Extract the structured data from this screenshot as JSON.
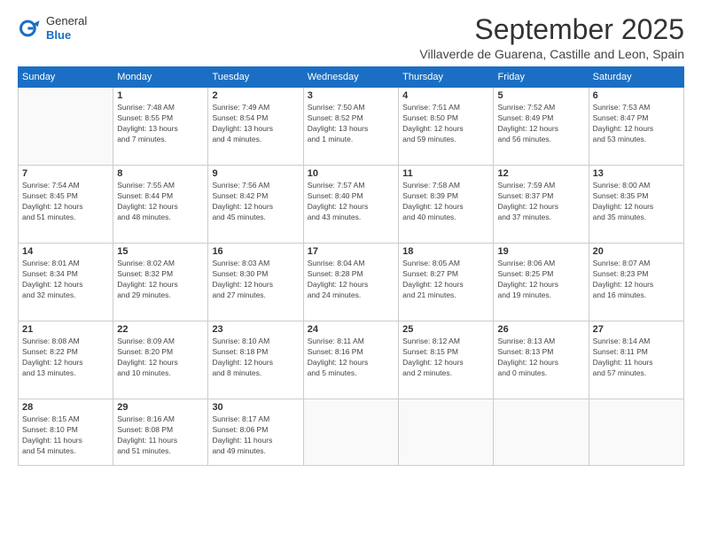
{
  "header": {
    "logo": {
      "line1": "General",
      "line2": "Blue"
    },
    "title": "September 2025",
    "location": "Villaverde de Guarena, Castille and Leon, Spain"
  },
  "weekdays": [
    "Sunday",
    "Monday",
    "Tuesday",
    "Wednesday",
    "Thursday",
    "Friday",
    "Saturday"
  ],
  "weeks": [
    [
      {
        "day": "",
        "info": ""
      },
      {
        "day": "1",
        "info": "Sunrise: 7:48 AM\nSunset: 8:55 PM\nDaylight: 13 hours\nand 7 minutes."
      },
      {
        "day": "2",
        "info": "Sunrise: 7:49 AM\nSunset: 8:54 PM\nDaylight: 13 hours\nand 4 minutes."
      },
      {
        "day": "3",
        "info": "Sunrise: 7:50 AM\nSunset: 8:52 PM\nDaylight: 13 hours\nand 1 minute."
      },
      {
        "day": "4",
        "info": "Sunrise: 7:51 AM\nSunset: 8:50 PM\nDaylight: 12 hours\nand 59 minutes."
      },
      {
        "day": "5",
        "info": "Sunrise: 7:52 AM\nSunset: 8:49 PM\nDaylight: 12 hours\nand 56 minutes."
      },
      {
        "day": "6",
        "info": "Sunrise: 7:53 AM\nSunset: 8:47 PM\nDaylight: 12 hours\nand 53 minutes."
      }
    ],
    [
      {
        "day": "7",
        "info": "Sunrise: 7:54 AM\nSunset: 8:45 PM\nDaylight: 12 hours\nand 51 minutes."
      },
      {
        "day": "8",
        "info": "Sunrise: 7:55 AM\nSunset: 8:44 PM\nDaylight: 12 hours\nand 48 minutes."
      },
      {
        "day": "9",
        "info": "Sunrise: 7:56 AM\nSunset: 8:42 PM\nDaylight: 12 hours\nand 45 minutes."
      },
      {
        "day": "10",
        "info": "Sunrise: 7:57 AM\nSunset: 8:40 PM\nDaylight: 12 hours\nand 43 minutes."
      },
      {
        "day": "11",
        "info": "Sunrise: 7:58 AM\nSunset: 8:39 PM\nDaylight: 12 hours\nand 40 minutes."
      },
      {
        "day": "12",
        "info": "Sunrise: 7:59 AM\nSunset: 8:37 PM\nDaylight: 12 hours\nand 37 minutes."
      },
      {
        "day": "13",
        "info": "Sunrise: 8:00 AM\nSunset: 8:35 PM\nDaylight: 12 hours\nand 35 minutes."
      }
    ],
    [
      {
        "day": "14",
        "info": "Sunrise: 8:01 AM\nSunset: 8:34 PM\nDaylight: 12 hours\nand 32 minutes."
      },
      {
        "day": "15",
        "info": "Sunrise: 8:02 AM\nSunset: 8:32 PM\nDaylight: 12 hours\nand 29 minutes."
      },
      {
        "day": "16",
        "info": "Sunrise: 8:03 AM\nSunset: 8:30 PM\nDaylight: 12 hours\nand 27 minutes."
      },
      {
        "day": "17",
        "info": "Sunrise: 8:04 AM\nSunset: 8:28 PM\nDaylight: 12 hours\nand 24 minutes."
      },
      {
        "day": "18",
        "info": "Sunrise: 8:05 AM\nSunset: 8:27 PM\nDaylight: 12 hours\nand 21 minutes."
      },
      {
        "day": "19",
        "info": "Sunrise: 8:06 AM\nSunset: 8:25 PM\nDaylight: 12 hours\nand 19 minutes."
      },
      {
        "day": "20",
        "info": "Sunrise: 8:07 AM\nSunset: 8:23 PM\nDaylight: 12 hours\nand 16 minutes."
      }
    ],
    [
      {
        "day": "21",
        "info": "Sunrise: 8:08 AM\nSunset: 8:22 PM\nDaylight: 12 hours\nand 13 minutes."
      },
      {
        "day": "22",
        "info": "Sunrise: 8:09 AM\nSunset: 8:20 PM\nDaylight: 12 hours\nand 10 minutes."
      },
      {
        "day": "23",
        "info": "Sunrise: 8:10 AM\nSunset: 8:18 PM\nDaylight: 12 hours\nand 8 minutes."
      },
      {
        "day": "24",
        "info": "Sunrise: 8:11 AM\nSunset: 8:16 PM\nDaylight: 12 hours\nand 5 minutes."
      },
      {
        "day": "25",
        "info": "Sunrise: 8:12 AM\nSunset: 8:15 PM\nDaylight: 12 hours\nand 2 minutes."
      },
      {
        "day": "26",
        "info": "Sunrise: 8:13 AM\nSunset: 8:13 PM\nDaylight: 12 hours\nand 0 minutes."
      },
      {
        "day": "27",
        "info": "Sunrise: 8:14 AM\nSunset: 8:11 PM\nDaylight: 11 hours\nand 57 minutes."
      }
    ],
    [
      {
        "day": "28",
        "info": "Sunrise: 8:15 AM\nSunset: 8:10 PM\nDaylight: 11 hours\nand 54 minutes."
      },
      {
        "day": "29",
        "info": "Sunrise: 8:16 AM\nSunset: 8:08 PM\nDaylight: 11 hours\nand 51 minutes."
      },
      {
        "day": "30",
        "info": "Sunrise: 8:17 AM\nSunset: 8:06 PM\nDaylight: 11 hours\nand 49 minutes."
      },
      {
        "day": "",
        "info": ""
      },
      {
        "day": "",
        "info": ""
      },
      {
        "day": "",
        "info": ""
      },
      {
        "day": "",
        "info": ""
      }
    ]
  ]
}
